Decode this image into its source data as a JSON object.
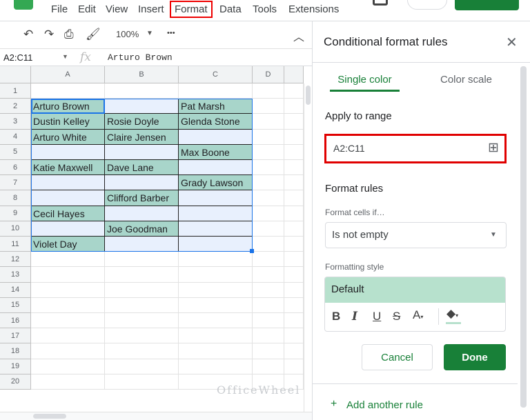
{
  "menu": [
    "File",
    "Edit",
    "View",
    "Insert",
    "Format",
    "Data",
    "Tools",
    "Extensions"
  ],
  "toolbar": {
    "zoom": "100%",
    "more": "•••"
  },
  "formula_bar": {
    "name_box": "A2:C11",
    "fx": "fx",
    "value": "Arturo Brown"
  },
  "columns": [
    "A",
    "B",
    "C",
    "D"
  ],
  "rows": [
    "1",
    "2",
    "3",
    "4",
    "5",
    "6",
    "7",
    "8",
    "9",
    "10",
    "11",
    "12",
    "13",
    "14",
    "15",
    "16",
    "17",
    "18",
    "19",
    "20"
  ],
  "cells": [
    [
      "Arturo Brown",
      "",
      "Pat Marsh"
    ],
    [
      "Dustin Kelley",
      "Rosie Doyle",
      "Glenda Stone"
    ],
    [
      "Arturo White",
      "Claire Jensen",
      ""
    ],
    [
      "",
      "",
      "Max Boone"
    ],
    [
      "Katie Maxwell",
      "Dave Lane",
      ""
    ],
    [
      "",
      "",
      "Grady Lawson"
    ],
    [
      "",
      "Clifford Barber",
      ""
    ],
    [
      "Cecil Hayes",
      "",
      ""
    ],
    [
      "",
      "Joe Goodman",
      ""
    ],
    [
      "Violet Day",
      "",
      ""
    ]
  ],
  "panel": {
    "title": "Conditional format rules",
    "tabs": [
      "Single color",
      "Color scale"
    ],
    "apply_label": "Apply to range",
    "range": "A2:C11",
    "format_rules": "Format rules",
    "cells_if_label": "Format cells if…",
    "condition": "Is not empty",
    "style_label": "Formatting style",
    "style_value": "Default",
    "cancel": "Cancel",
    "done": "Done",
    "add_rule": "Add another rule"
  },
  "watermark": "OfficeWheel",
  "colors": {
    "accent": "#188038",
    "filled": "#a8d5ca",
    "empty": "#e8f0fd",
    "style_preview": "#b7e1cd",
    "highlight": "#e00000"
  }
}
